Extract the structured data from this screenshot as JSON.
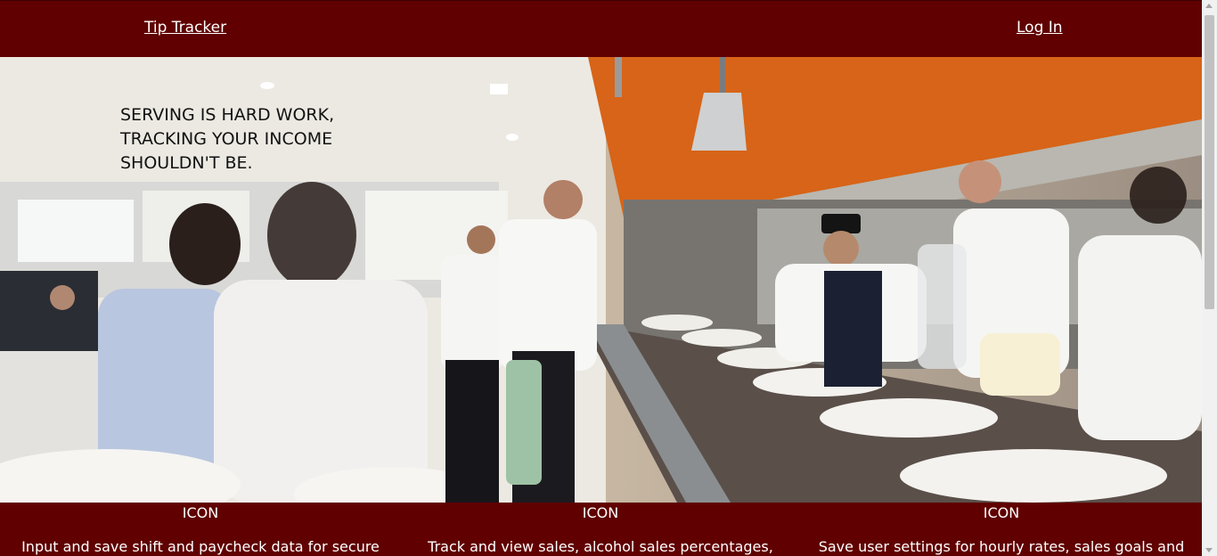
{
  "nav": {
    "brand_label": "Tip Tracker",
    "login_label": "Log In"
  },
  "hero": {
    "headline_line1": "SERVING IS HARD WORK,",
    "headline_line2": "TRACKING YOUR INCOME",
    "headline_line3": "SHOULDN'T BE.",
    "image_icon": "restaurant-photo"
  },
  "features": [
    {
      "icon_label": "ICON",
      "description": "Input and save shift and paycheck data for secure"
    },
    {
      "icon_label": "ICON",
      "description": "Track and view sales, alcohol sales percentages,"
    },
    {
      "icon_label": "ICON",
      "description": "Save user settings for hourly rates, sales goals and"
    }
  ],
  "colors": {
    "brand": "#600000",
    "text_on_brand": "#ffffff",
    "accent_orange": "#d76418"
  }
}
